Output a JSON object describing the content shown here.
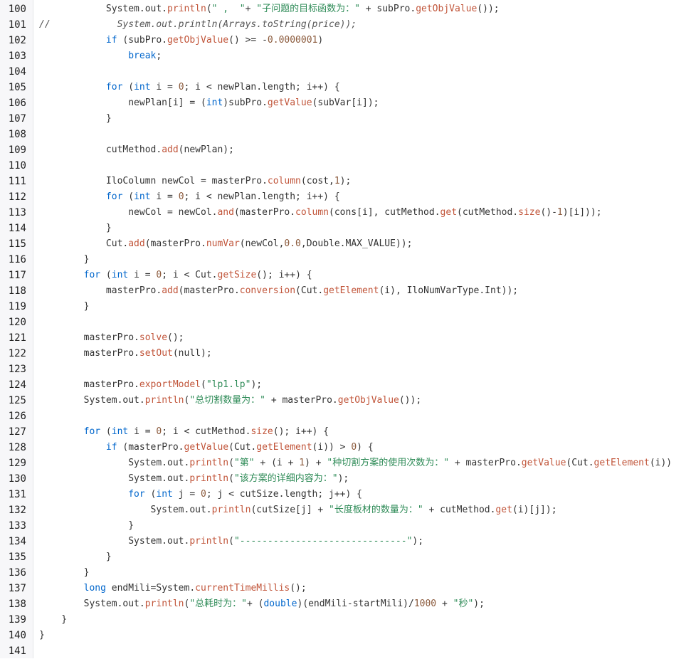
{
  "colors": {
    "default": "#333333",
    "keyword": "#0066cc",
    "method": "#c1553a",
    "string": "#2e8b57",
    "number": "#8b5a3c",
    "comment": "#555555",
    "gutter_bg": "#f7f7f9",
    "line_number": "#1f1f1f"
  },
  "lines": [
    {
      "no": "100",
      "tokens": [
        {
          "t": "            System.out.",
          "k": "default"
        },
        {
          "t": "println",
          "k": "method"
        },
        {
          "t": "(",
          "k": "default"
        },
        {
          "t": "\" ,  \"",
          "k": "string"
        },
        {
          "t": "+ ",
          "k": "default"
        },
        {
          "t": "\"子问题的目标函数为：\"",
          "k": "string"
        },
        {
          "t": " + subPro.",
          "k": "default"
        },
        {
          "t": "getObjValue",
          "k": "method"
        },
        {
          "t": "());",
          "k": "default"
        }
      ]
    },
    {
      "no": "101",
      "tokens": [
        {
          "t": "//            System.out.println(Arrays.toString(price));",
          "k": "comment",
          "italic": true
        }
      ]
    },
    {
      "no": "102",
      "tokens": [
        {
          "t": "            ",
          "k": "default"
        },
        {
          "t": "if",
          "k": "keyword"
        },
        {
          "t": " (subPro.",
          "k": "default"
        },
        {
          "t": "getObjValue",
          "k": "method"
        },
        {
          "t": "() >= -",
          "k": "default"
        },
        {
          "t": "0.0000001",
          "k": "number"
        },
        {
          "t": ")",
          "k": "default"
        }
      ]
    },
    {
      "no": "103",
      "tokens": [
        {
          "t": "                ",
          "k": "default"
        },
        {
          "t": "break",
          "k": "keyword"
        },
        {
          "t": ";",
          "k": "default"
        }
      ]
    },
    {
      "no": "104",
      "tokens": []
    },
    {
      "no": "105",
      "tokens": [
        {
          "t": "            ",
          "k": "default"
        },
        {
          "t": "for",
          "k": "keyword"
        },
        {
          "t": " (",
          "k": "default"
        },
        {
          "t": "int",
          "k": "keyword"
        },
        {
          "t": " i = ",
          "k": "default"
        },
        {
          "t": "0",
          "k": "number"
        },
        {
          "t": "; i < newPlan.length; i++) {",
          "k": "default"
        }
      ]
    },
    {
      "no": "106",
      "tokens": [
        {
          "t": "                newPlan[i] = (",
          "k": "default"
        },
        {
          "t": "int",
          "k": "keyword"
        },
        {
          "t": ")subPro.",
          "k": "default"
        },
        {
          "t": "getValue",
          "k": "method"
        },
        {
          "t": "(subVar[i]);",
          "k": "default"
        }
      ]
    },
    {
      "no": "107",
      "tokens": [
        {
          "t": "            }",
          "k": "default"
        }
      ]
    },
    {
      "no": "108",
      "tokens": []
    },
    {
      "no": "109",
      "tokens": [
        {
          "t": "            cutMethod.",
          "k": "default"
        },
        {
          "t": "add",
          "k": "method"
        },
        {
          "t": "(newPlan);",
          "k": "default"
        }
      ]
    },
    {
      "no": "110",
      "tokens": []
    },
    {
      "no": "111",
      "tokens": [
        {
          "t": "            IloColumn newCol = masterPro.",
          "k": "default"
        },
        {
          "t": "column",
          "k": "method"
        },
        {
          "t": "(cost,",
          "k": "default"
        },
        {
          "t": "1",
          "k": "number"
        },
        {
          "t": ");",
          "k": "default"
        }
      ]
    },
    {
      "no": "112",
      "tokens": [
        {
          "t": "            ",
          "k": "default"
        },
        {
          "t": "for",
          "k": "keyword"
        },
        {
          "t": " (",
          "k": "default"
        },
        {
          "t": "int",
          "k": "keyword"
        },
        {
          "t": " i = ",
          "k": "default"
        },
        {
          "t": "0",
          "k": "number"
        },
        {
          "t": "; i < newPlan.length; i++) {",
          "k": "default"
        }
      ]
    },
    {
      "no": "113",
      "tokens": [
        {
          "t": "                newCol = newCol.",
          "k": "default"
        },
        {
          "t": "and",
          "k": "method"
        },
        {
          "t": "(masterPro.",
          "k": "default"
        },
        {
          "t": "column",
          "k": "method"
        },
        {
          "t": "(cons[i], cutMethod.",
          "k": "default"
        },
        {
          "t": "get",
          "k": "method"
        },
        {
          "t": "(cutMethod.",
          "k": "default"
        },
        {
          "t": "size",
          "k": "method"
        },
        {
          "t": "()-",
          "k": "default"
        },
        {
          "t": "1",
          "k": "number"
        },
        {
          "t": ")[i]));",
          "k": "default"
        }
      ]
    },
    {
      "no": "114",
      "tokens": [
        {
          "t": "            }",
          "k": "default"
        }
      ]
    },
    {
      "no": "115",
      "tokens": [
        {
          "t": "            Cut.",
          "k": "default"
        },
        {
          "t": "add",
          "k": "method"
        },
        {
          "t": "(masterPro.",
          "k": "default"
        },
        {
          "t": "numVar",
          "k": "method"
        },
        {
          "t": "(newCol,",
          "k": "default"
        },
        {
          "t": "0.0",
          "k": "number"
        },
        {
          "t": ",Double.MAX_VALUE));",
          "k": "default"
        }
      ]
    },
    {
      "no": "116",
      "tokens": [
        {
          "t": "        }",
          "k": "default"
        }
      ]
    },
    {
      "no": "117",
      "tokens": [
        {
          "t": "        ",
          "k": "default"
        },
        {
          "t": "for",
          "k": "keyword"
        },
        {
          "t": " (",
          "k": "default"
        },
        {
          "t": "int",
          "k": "keyword"
        },
        {
          "t": " i = ",
          "k": "default"
        },
        {
          "t": "0",
          "k": "number"
        },
        {
          "t": "; i < Cut.",
          "k": "default"
        },
        {
          "t": "getSize",
          "k": "method"
        },
        {
          "t": "(); i++) {",
          "k": "default"
        }
      ]
    },
    {
      "no": "118",
      "tokens": [
        {
          "t": "            masterPro.",
          "k": "default"
        },
        {
          "t": "add",
          "k": "method"
        },
        {
          "t": "(masterPro.",
          "k": "default"
        },
        {
          "t": "conversion",
          "k": "method"
        },
        {
          "t": "(Cut.",
          "k": "default"
        },
        {
          "t": "getElement",
          "k": "method"
        },
        {
          "t": "(i), IloNumVarType.Int));",
          "k": "default"
        }
      ]
    },
    {
      "no": "119",
      "tokens": [
        {
          "t": "        }",
          "k": "default"
        }
      ]
    },
    {
      "no": "120",
      "tokens": []
    },
    {
      "no": "121",
      "tokens": [
        {
          "t": "        masterPro.",
          "k": "default"
        },
        {
          "t": "solve",
          "k": "method"
        },
        {
          "t": "();",
          "k": "default"
        }
      ]
    },
    {
      "no": "122",
      "tokens": [
        {
          "t": "        masterPro.",
          "k": "default"
        },
        {
          "t": "setOut",
          "k": "method"
        },
        {
          "t": "(null);",
          "k": "default"
        }
      ]
    },
    {
      "no": "123",
      "tokens": []
    },
    {
      "no": "124",
      "tokens": [
        {
          "t": "        masterPro.",
          "k": "default"
        },
        {
          "t": "exportModel",
          "k": "method"
        },
        {
          "t": "(",
          "k": "default"
        },
        {
          "t": "\"lp1.lp\"",
          "k": "string"
        },
        {
          "t": ");",
          "k": "default"
        }
      ]
    },
    {
      "no": "125",
      "tokens": [
        {
          "t": "        System.out.",
          "k": "default"
        },
        {
          "t": "println",
          "k": "method"
        },
        {
          "t": "(",
          "k": "default"
        },
        {
          "t": "\"总切割数量为：\"",
          "k": "string"
        },
        {
          "t": " + masterPro.",
          "k": "default"
        },
        {
          "t": "getObjValue",
          "k": "method"
        },
        {
          "t": "());",
          "k": "default"
        }
      ]
    },
    {
      "no": "126",
      "tokens": []
    },
    {
      "no": "127",
      "tokens": [
        {
          "t": "        ",
          "k": "default"
        },
        {
          "t": "for",
          "k": "keyword"
        },
        {
          "t": " (",
          "k": "default"
        },
        {
          "t": "int",
          "k": "keyword"
        },
        {
          "t": " i = ",
          "k": "default"
        },
        {
          "t": "0",
          "k": "number"
        },
        {
          "t": "; i < cutMethod.",
          "k": "default"
        },
        {
          "t": "size",
          "k": "method"
        },
        {
          "t": "(); i++) {",
          "k": "default"
        }
      ]
    },
    {
      "no": "128",
      "tokens": [
        {
          "t": "            ",
          "k": "default"
        },
        {
          "t": "if",
          "k": "keyword"
        },
        {
          "t": " (masterPro.",
          "k": "default"
        },
        {
          "t": "getValue",
          "k": "method"
        },
        {
          "t": "(Cut.",
          "k": "default"
        },
        {
          "t": "getElement",
          "k": "method"
        },
        {
          "t": "(i)) > ",
          "k": "default"
        },
        {
          "t": "0",
          "k": "number"
        },
        {
          "t": ") {",
          "k": "default"
        }
      ]
    },
    {
      "no": "129",
      "tokens": [
        {
          "t": "                System.out.",
          "k": "default"
        },
        {
          "t": "println",
          "k": "method"
        },
        {
          "t": "(",
          "k": "default"
        },
        {
          "t": "\"第\"",
          "k": "string"
        },
        {
          "t": " + (i + ",
          "k": "default"
        },
        {
          "t": "1",
          "k": "number"
        },
        {
          "t": ") + ",
          "k": "default"
        },
        {
          "t": "\"种切割方案的使用次数为：\"",
          "k": "string"
        },
        {
          "t": " + masterPro.",
          "k": "default"
        },
        {
          "t": "getValue",
          "k": "method"
        },
        {
          "t": "(Cut.",
          "k": "default"
        },
        {
          "t": "getElement",
          "k": "method"
        },
        {
          "t": "(i))",
          "k": "default"
        }
      ]
    },
    {
      "no": "130",
      "tokens": [
        {
          "t": "                System.out.",
          "k": "default"
        },
        {
          "t": "println",
          "k": "method"
        },
        {
          "t": "(",
          "k": "default"
        },
        {
          "t": "\"该方案的详细内容为：\"",
          "k": "string"
        },
        {
          "t": ");",
          "k": "default"
        }
      ]
    },
    {
      "no": "131",
      "tokens": [
        {
          "t": "                ",
          "k": "default"
        },
        {
          "t": "for",
          "k": "keyword"
        },
        {
          "t": " (",
          "k": "default"
        },
        {
          "t": "int",
          "k": "keyword"
        },
        {
          "t": " j = ",
          "k": "default"
        },
        {
          "t": "0",
          "k": "number"
        },
        {
          "t": "; j < cutSize.length; j++) {",
          "k": "default"
        }
      ]
    },
    {
      "no": "132",
      "tokens": [
        {
          "t": "                    System.out.",
          "k": "default"
        },
        {
          "t": "println",
          "k": "method"
        },
        {
          "t": "(cutSize[j] + ",
          "k": "default"
        },
        {
          "t": "\"长度板材的数量为：\"",
          "k": "string"
        },
        {
          "t": " + cutMethod.",
          "k": "default"
        },
        {
          "t": "get",
          "k": "method"
        },
        {
          "t": "(i)[j]);",
          "k": "default"
        }
      ]
    },
    {
      "no": "133",
      "tokens": [
        {
          "t": "                }",
          "k": "default"
        }
      ]
    },
    {
      "no": "134",
      "tokens": [
        {
          "t": "                System.out.",
          "k": "default"
        },
        {
          "t": "println",
          "k": "method"
        },
        {
          "t": "(",
          "k": "default"
        },
        {
          "t": "\"------------------------------\"",
          "k": "string"
        },
        {
          "t": ");",
          "k": "default"
        }
      ]
    },
    {
      "no": "135",
      "tokens": [
        {
          "t": "            }",
          "k": "default"
        }
      ]
    },
    {
      "no": "136",
      "tokens": [
        {
          "t": "        }",
          "k": "default"
        }
      ]
    },
    {
      "no": "137",
      "tokens": [
        {
          "t": "        ",
          "k": "default"
        },
        {
          "t": "long",
          "k": "keyword"
        },
        {
          "t": " endMili=System.",
          "k": "default"
        },
        {
          "t": "currentTimeMillis",
          "k": "method"
        },
        {
          "t": "();",
          "k": "default"
        }
      ]
    },
    {
      "no": "138",
      "tokens": [
        {
          "t": "        System.out.",
          "k": "default"
        },
        {
          "t": "println",
          "k": "method"
        },
        {
          "t": "(",
          "k": "default"
        },
        {
          "t": "\"总耗时为：\"",
          "k": "string"
        },
        {
          "t": "+ (",
          "k": "default"
        },
        {
          "t": "double",
          "k": "keyword"
        },
        {
          "t": ")(endMili-startMili)/",
          "k": "default"
        },
        {
          "t": "1000",
          "k": "number"
        },
        {
          "t": " + ",
          "k": "default"
        },
        {
          "t": "\"秒\"",
          "k": "string"
        },
        {
          "t": ");",
          "k": "default"
        }
      ]
    },
    {
      "no": "139",
      "tokens": [
        {
          "t": "    }",
          "k": "default"
        }
      ]
    },
    {
      "no": "140",
      "tokens": [
        {
          "t": "}",
          "k": "default"
        }
      ]
    },
    {
      "no": "141",
      "tokens": []
    }
  ]
}
